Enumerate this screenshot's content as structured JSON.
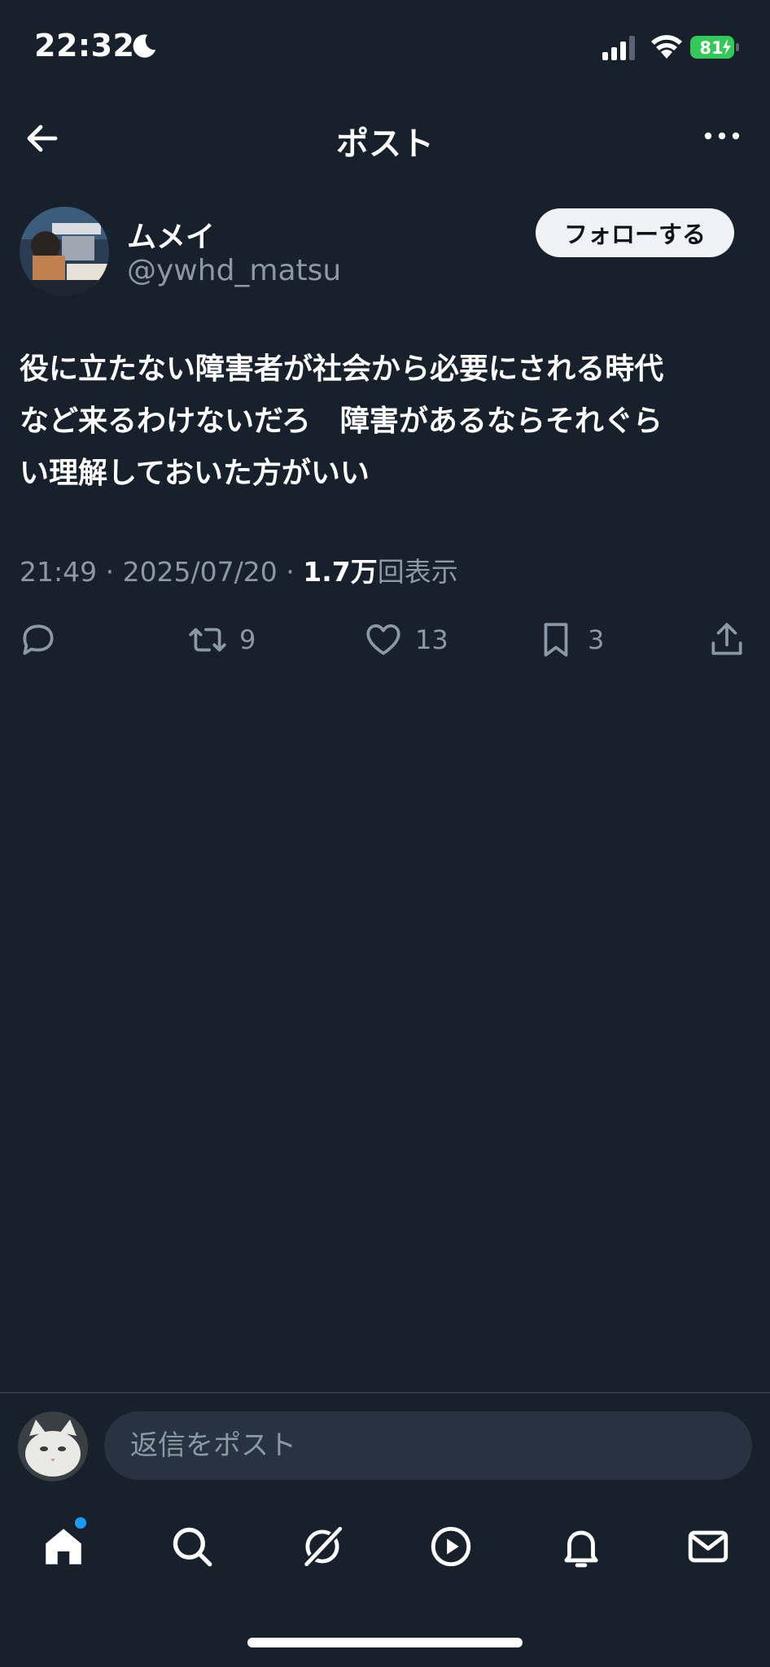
{
  "status_bar": {
    "time": "22:32",
    "battery": "81",
    "battery_color": "#34c759"
  },
  "header": {
    "title": "ポスト"
  },
  "post": {
    "author_name": "ムメイ",
    "author_handle": "@ywhd_matsu",
    "follow_label": "フォローする",
    "text": "役に立たない障害者が社会から必要にされる時代\nなど来るわけないだろ　障害があるならそれぐら\nい理解しておいた方がいい",
    "timestamp": "21:49 · 2025/07/20 · ",
    "views_count": "1.7万",
    "views_label": "回表示",
    "retweets": "9",
    "likes": "13",
    "bookmarks": "3"
  },
  "reply": {
    "placeholder": "返信をポスト"
  },
  "icons": {
    "tab_home": "home-icon",
    "tab_search": "search-icon",
    "tab_grok": "grok-icon",
    "tab_video": "play-icon",
    "tab_notifications": "bell-icon",
    "tab_messages": "mail-icon"
  },
  "colors": {
    "background": "#17202b",
    "accent": "#1d9bf0",
    "muted": "#8b98a5"
  }
}
